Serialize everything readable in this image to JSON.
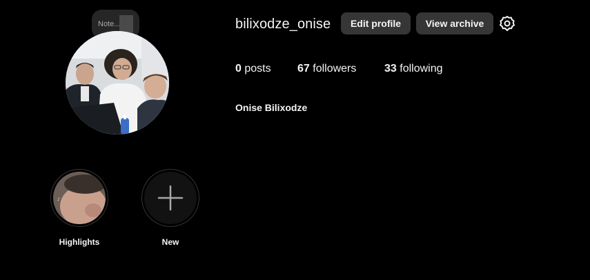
{
  "note": {
    "label": "Note..."
  },
  "profile": {
    "username": "bilixodze_onise",
    "full_name": "Onise Bilixodze",
    "avatar_icon": "profile-photo"
  },
  "actions": {
    "edit_profile": "Edit profile",
    "view_archive": "View archive",
    "settings_icon": "gear-icon"
  },
  "stats": {
    "posts_count": "0",
    "posts_label": "posts",
    "followers_count": "67",
    "followers_label": "followers",
    "following_count": "33",
    "following_label": "following"
  },
  "highlights": [
    {
      "label": "Highlights"
    },
    {
      "label": "New",
      "icon": "plus-icon"
    }
  ]
}
